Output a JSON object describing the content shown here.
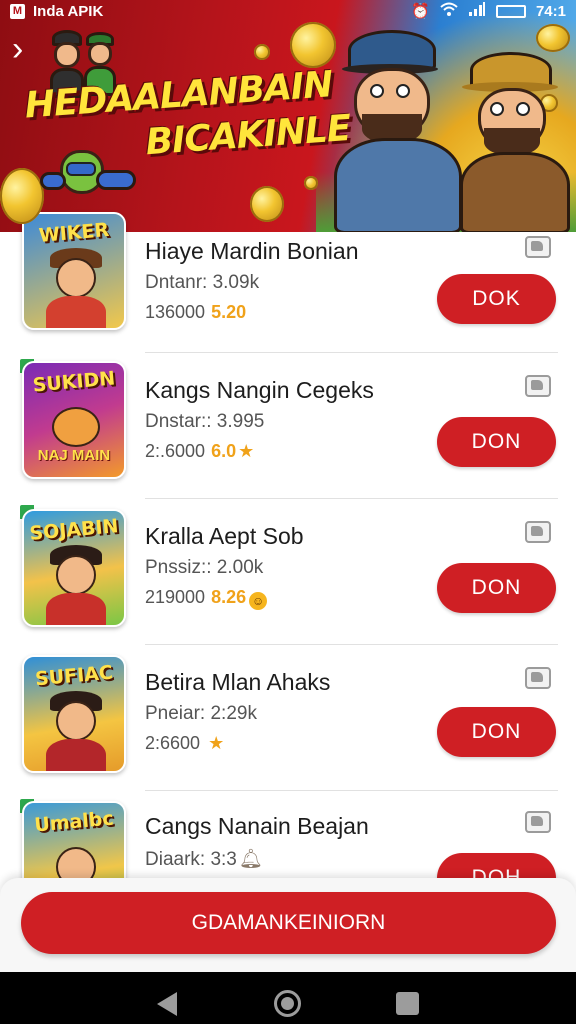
{
  "status_bar": {
    "app_badge": "M",
    "app_name": "Inda APIK",
    "time": "74:1"
  },
  "banner": {
    "title_line1": "HEDAALANBAIN",
    "title_line2": "BICAKINLE"
  },
  "apps": [
    {
      "thumb_label": "WIKER",
      "title": "Hiaye Mardin Bonian",
      "meta_line": "Dntanr: 3.09k",
      "count": "136000",
      "rating": "5.20",
      "rating_icon": "none",
      "button": "DOK",
      "thumb_colors": [
        "#3d8ad8",
        "#f2c84b"
      ]
    },
    {
      "thumb_label": "SUKIDN",
      "thumb_sub": "NAJ MAIN",
      "title": "Kangs Nangin Cegeks",
      "meta_line": "Dnstar:: 3.995",
      "count": "2:.6000",
      "rating": "6.0",
      "rating_icon": "star",
      "button": "DON",
      "thumb_colors": [
        "#7a2ab5",
        "#f39a2a"
      ]
    },
    {
      "thumb_label": "SOJABIN",
      "title": "Kralla Aept Sob",
      "meta_line": "Pnssiz:: 2.00k",
      "count": "219000",
      "rating": "8.26",
      "rating_icon": "smile",
      "button": "DON",
      "thumb_colors": [
        "#2f9be0",
        "#7bc645"
      ]
    },
    {
      "thumb_label": "SUFIAC",
      "title": "Betira Mlan Ahaks",
      "meta_line": "Pneiar: 2:29k",
      "count": "2:6600",
      "rating": "",
      "rating_icon": "star",
      "button": "DON",
      "thumb_colors": [
        "#2f8fd8",
        "#f4c542"
      ]
    },
    {
      "thumb_label": "Umalbc",
      "title": "Cangs Nanain Beajan",
      "meta_line": "Diaark: 3:3",
      "count": "",
      "rating": "",
      "rating_icon": "bell",
      "button": "DOH",
      "thumb_colors": [
        "#3a9ad8",
        "#7fc24a"
      ]
    }
  ],
  "bottom_button": "GDAMANKEINIORN",
  "colors": {
    "accent_red": "#cf1f24",
    "rating_orange": "#f0a21a",
    "nav_bar": "#000000"
  },
  "icons": [
    "back-chevron-icon",
    "alarm-icon",
    "wifi-icon",
    "signal-icon",
    "battery-icon",
    "checkbox-icon",
    "star-icon",
    "nav-back-icon",
    "nav-home-icon",
    "nav-recents-icon"
  ]
}
